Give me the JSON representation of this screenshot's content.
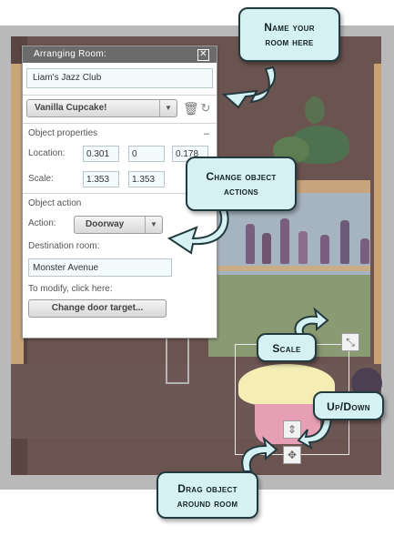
{
  "panel": {
    "title": "Arranging Room:",
    "close_glyph": "✕",
    "room_name": "Liam's Jazz Club",
    "object_select": "Vanilla Cupcake!",
    "object_properties_label": "Object properties",
    "collapse_glyph": "–",
    "location_label": "Location:",
    "location": [
      "0.301",
      "0",
      "0.178"
    ],
    "scale_label": "Scale:",
    "scale": [
      "1.353",
      "1.353"
    ],
    "object_action_label": "Object action",
    "action_label": "Action:",
    "action_value": "Doorway",
    "destination_label": "Destination room:",
    "destination_value": "Monster Avenue",
    "modify_label": "To modify, click here:",
    "change_button": "Change door target..."
  },
  "callouts": {
    "name_room": [
      "Name your",
      "room here"
    ],
    "change_actions": [
      "Change object",
      "actions"
    ],
    "scale": "Scale",
    "up_down": "Up/Down",
    "drag": [
      "Drag object",
      "around room"
    ]
  },
  "icons": {
    "trash": "trash-icon",
    "undo": "undo-icon",
    "scale_handle": "resize-icon",
    "up_down_handle": "up-down-arrow-icon",
    "drag_handle": "move-icon"
  },
  "colors": {
    "callout_bg": "#d6f1f4",
    "callout_border": "#223a3e",
    "panel_title_bg": "#6b6b6b",
    "arrow_fill": "#d6f1f4"
  }
}
